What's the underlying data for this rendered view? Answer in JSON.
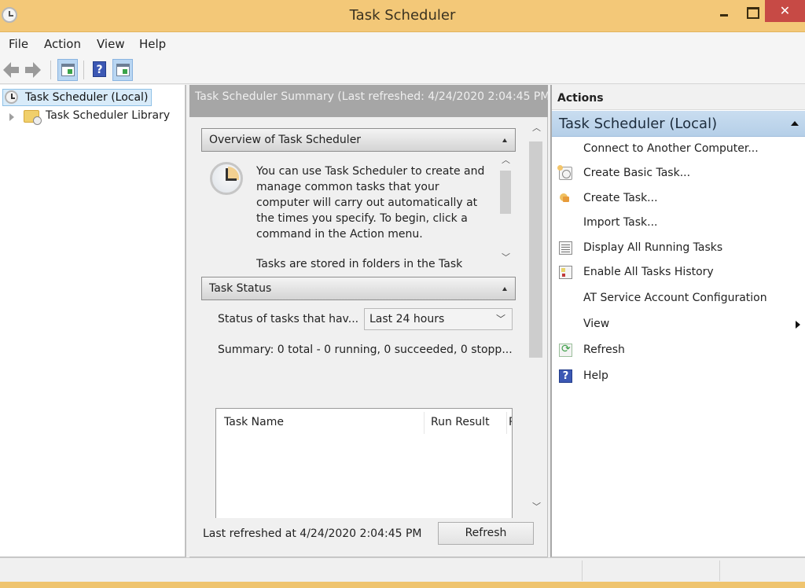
{
  "window": {
    "title": "Task Scheduler",
    "close_glyph": "✕"
  },
  "menu": {
    "items": [
      {
        "label": "File"
      },
      {
        "label": "Action"
      },
      {
        "label": "View"
      },
      {
        "label": "Help"
      }
    ]
  },
  "toolbar": {
    "buttons": [
      {
        "name": "back",
        "icon": "arrow-left-icon"
      },
      {
        "name": "forward",
        "icon": "arrow-right-icon"
      },
      {
        "name": "show-hide-console-tree",
        "icon": "console-tree-icon"
      },
      {
        "name": "help",
        "icon": "help-icon",
        "glyph": "?"
      },
      {
        "name": "show-hide-action-pane",
        "icon": "action-pane-icon"
      }
    ]
  },
  "tree": {
    "root": {
      "label": "Task Scheduler (Local)",
      "icon": "clock-icon",
      "selected": true
    },
    "children": [
      {
        "label": "Task Scheduler Library",
        "icon": "folder-clock-icon",
        "expanded": false
      }
    ]
  },
  "center": {
    "header": "Task Scheduler Summary (Last refreshed: 4/24/2020 2:04:45 PM)",
    "overview": {
      "title": "Overview of Task Scheduler",
      "paragraphs": [
        "You can use Task Scheduler to create and manage common tasks that your computer will carry out automatically at the times you specify. To begin, click a command in the Action menu.",
        "Tasks are stored in folders in the Task Scheduler Library."
      ]
    },
    "status": {
      "title": "Task Status",
      "filter_label": "Status of tasks that hav...",
      "filter_value": "Last 24 hours",
      "summary": "Summary: 0 total - 0 running, 0 succeeded, 0 stopp...",
      "table": {
        "columns": [
          "Task Name",
          "Run Result",
          "R"
        ],
        "rows": []
      }
    },
    "footer": {
      "last_refreshed": "Last refreshed at 4/24/2020 2:04:45 PM",
      "refresh_label": "Refresh"
    }
  },
  "actions": {
    "header": "Actions",
    "group": "Task Scheduler (Local)",
    "items": [
      {
        "label": "Connect to Another Computer...",
        "icon": null
      },
      {
        "label": "Create Basic Task...",
        "icon": "create-basic-task-icon"
      },
      {
        "label": "Create Task...",
        "icon": "create-task-icon"
      },
      {
        "label": "Import Task...",
        "icon": null
      },
      {
        "label": "Display All Running Tasks",
        "icon": "running-tasks-icon"
      },
      {
        "label": "Enable All Tasks History",
        "icon": "tasks-history-icon"
      },
      {
        "label": "AT Service Account Configuration",
        "icon": null
      },
      {
        "label": "View",
        "icon": null,
        "submenu": true
      },
      {
        "label": "Refresh",
        "icon": "refresh-icon"
      },
      {
        "label": "Help",
        "icon": "help-icon",
        "glyph": "?"
      }
    ]
  },
  "colors": {
    "titlebar": "#f3c878",
    "close_button": "#c74a45",
    "actions_group": "#c9ddf0",
    "center_header": "#a6a6a6",
    "selection": "#d8ebf9"
  }
}
